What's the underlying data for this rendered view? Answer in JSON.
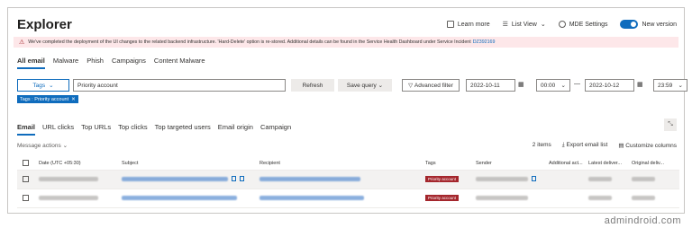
{
  "header": {
    "title": "Explorer",
    "learn_more": "Learn more",
    "list_view": "List View",
    "mde_settings": "MDE Settings",
    "new_version": "New version",
    "accent": "#0f6cbd"
  },
  "banner": {
    "text": "We've completed the deployment of the UI changes to the related backend infrastructure. 'Hard-Delete' option is re-stored. Additional details can be found in the Service Health Dashboard under Service Incident",
    "incident": "DZ392169"
  },
  "top_tabs": [
    "All email",
    "Malware",
    "Phish",
    "Campaigns",
    "Content Malware"
  ],
  "filters": {
    "tags_label": "Tags",
    "query_value": "Priority account",
    "refresh": "Refresh",
    "save_query": "Save query",
    "advanced_filter": "Advanced filter",
    "start_date": "2022-10-11",
    "start_time": "00:00",
    "end_date": "2022-10-12",
    "end_time": "23:59",
    "chip": "Tags : Priority account"
  },
  "result_tabs": [
    "Email",
    "URL clicks",
    "Top URLs",
    "Top clicks",
    "Top targeted users",
    "Email origin",
    "Campaign"
  ],
  "toolbar": {
    "message_actions": "Message actions",
    "count": "2 items",
    "export": "Export email list",
    "customize": "Customize columns"
  },
  "table": {
    "columns": [
      "Date (UTC +05:30)",
      "Subject",
      "Recipient",
      "Tags",
      "Sender",
      "Additional act...",
      "Latest deliver...",
      "Original deliv..."
    ],
    "rows": [
      {
        "tag": "Priority account"
      },
      {
        "tag": "Priority account"
      }
    ],
    "tag_color": "#a4262c"
  },
  "watermark": "admindroid.com"
}
